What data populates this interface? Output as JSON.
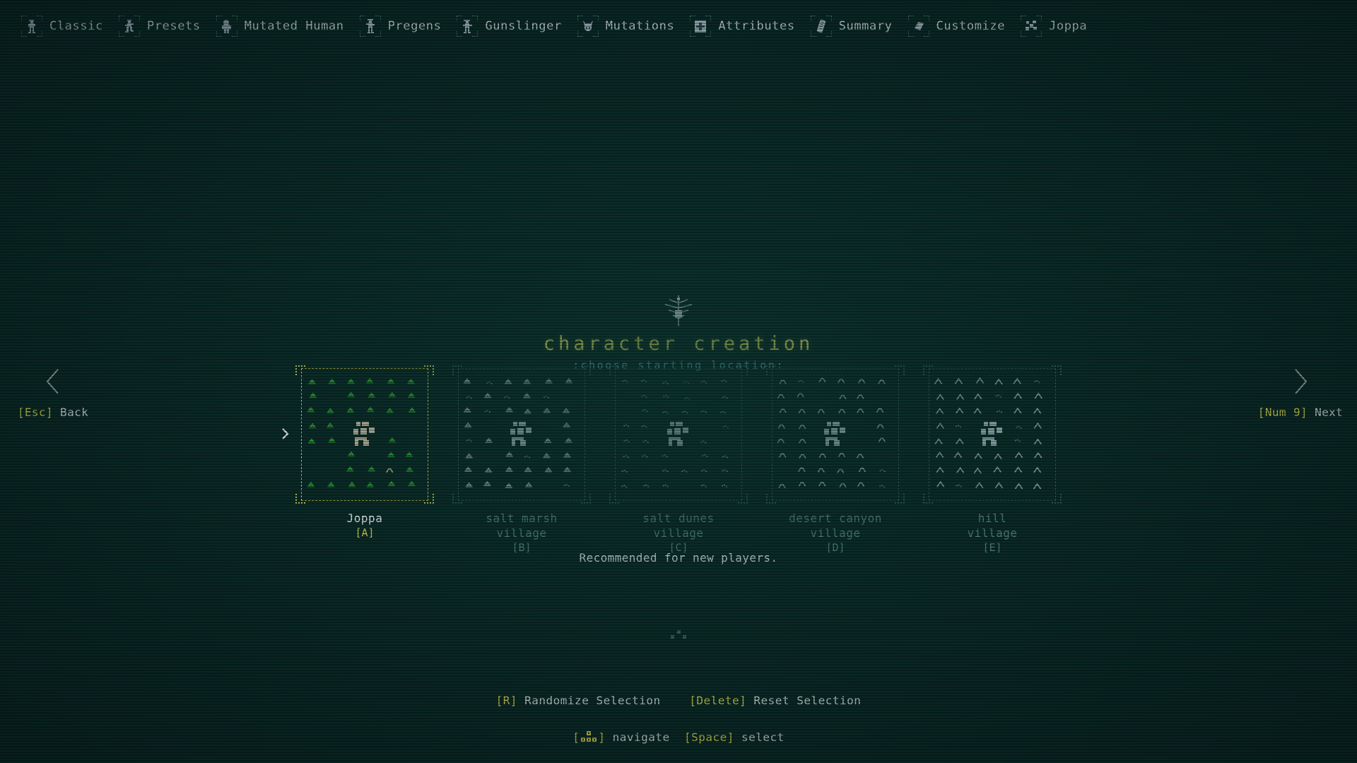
{
  "app": {
    "title": "character creation",
    "subtitle": ":choose starting location:",
    "background_color": "#0a2a27",
    "accent_yellow": "#c8c84e",
    "accent_teal": "#53a0a6",
    "text_color": "#c6d4d2",
    "dim_color": "#4e7e7c"
  },
  "topnav": {
    "items": [
      {
        "label": "Classic",
        "icon": "gunslinger-figure-icon"
      },
      {
        "label": "Presets",
        "icon": "running-figure-icon"
      },
      {
        "label": "Mutated Human",
        "icon": "mutated-human-icon"
      },
      {
        "label": "Pregens",
        "icon": "pregen-figure-icon"
      },
      {
        "label": "Gunslinger",
        "icon": "gunslinger-icon"
      },
      {
        "label": "Mutations",
        "icon": "horned-skull-icon"
      },
      {
        "label": "Attributes",
        "icon": "attribute-block-icon"
      },
      {
        "label": "Summary",
        "icon": "scroll-icon"
      },
      {
        "label": "Customize",
        "icon": "gem-icon"
      },
      {
        "label": "Joppa",
        "icon": "village-map-icon"
      }
    ]
  },
  "side_nav": {
    "left": {
      "key": "[Esc]",
      "label": "Back",
      "icon": "chevron-left-icon"
    },
    "right": {
      "key": "[Num 9]",
      "label": "Next",
      "icon": "chevron-right-icon"
    }
  },
  "locations": [
    {
      "name": "Joppa",
      "name_line2": "",
      "key": "[A]",
      "selected": true,
      "biome": "village-oasis",
      "palette": {
        "plant": "#2f9e36",
        "plant_dark": "#1f6e26",
        "water": "#2a5fbf",
        "building": "#b9b09a",
        "sand": "#c3b189"
      }
    },
    {
      "name": "salt marsh",
      "name_line2": "village",
      "key": "[B]",
      "selected": false,
      "biome": "salt-marsh",
      "palette": {
        "plant": "#7d9aa0",
        "plant_dark": "#5d7a80",
        "water": "#5d7a80",
        "building": "#8fa6ab",
        "sand": "#7d9aa0"
      }
    },
    {
      "name": "salt dunes",
      "name_line2": "village",
      "key": "[C]",
      "selected": false,
      "biome": "salt-dunes",
      "palette": {
        "plant": "#6e8b90",
        "plant_dark": "#4e6b70",
        "water": "#4e6b70",
        "building": "#8fa6ab",
        "sand": "#6e8b90"
      }
    },
    {
      "name": "desert canyon",
      "name_line2": "village",
      "key": "[D]",
      "selected": false,
      "biome": "desert-canyon",
      "palette": {
        "plant": "#7d9aa0",
        "plant_dark": "#5d7a80",
        "water": "#5d7a80",
        "building": "#8fa6ab",
        "sand": "#7d9aa0"
      }
    },
    {
      "name": "hill",
      "name_line2": "village",
      "key": "[E]",
      "selected": false,
      "biome": "hills",
      "palette": {
        "plant": "#7d9aa0",
        "plant_dark": "#5d7a80",
        "water": "#5d7a80",
        "building": "#8fa6ab",
        "sand": "#7d9aa0"
      }
    }
  ],
  "recommendation": "Recommended for new players.",
  "footer": {
    "randomize_key": "[R]",
    "randomize_label": "Randomize Selection",
    "reset_key": "[Delete]",
    "reset_label": "Reset Selection",
    "navigate_icon": "arrow-keys-icon",
    "navigate_bracket_open": "[",
    "navigate_bracket_close": "]",
    "navigate_label": "navigate",
    "select_key": "[Space]",
    "select_label": "select"
  }
}
